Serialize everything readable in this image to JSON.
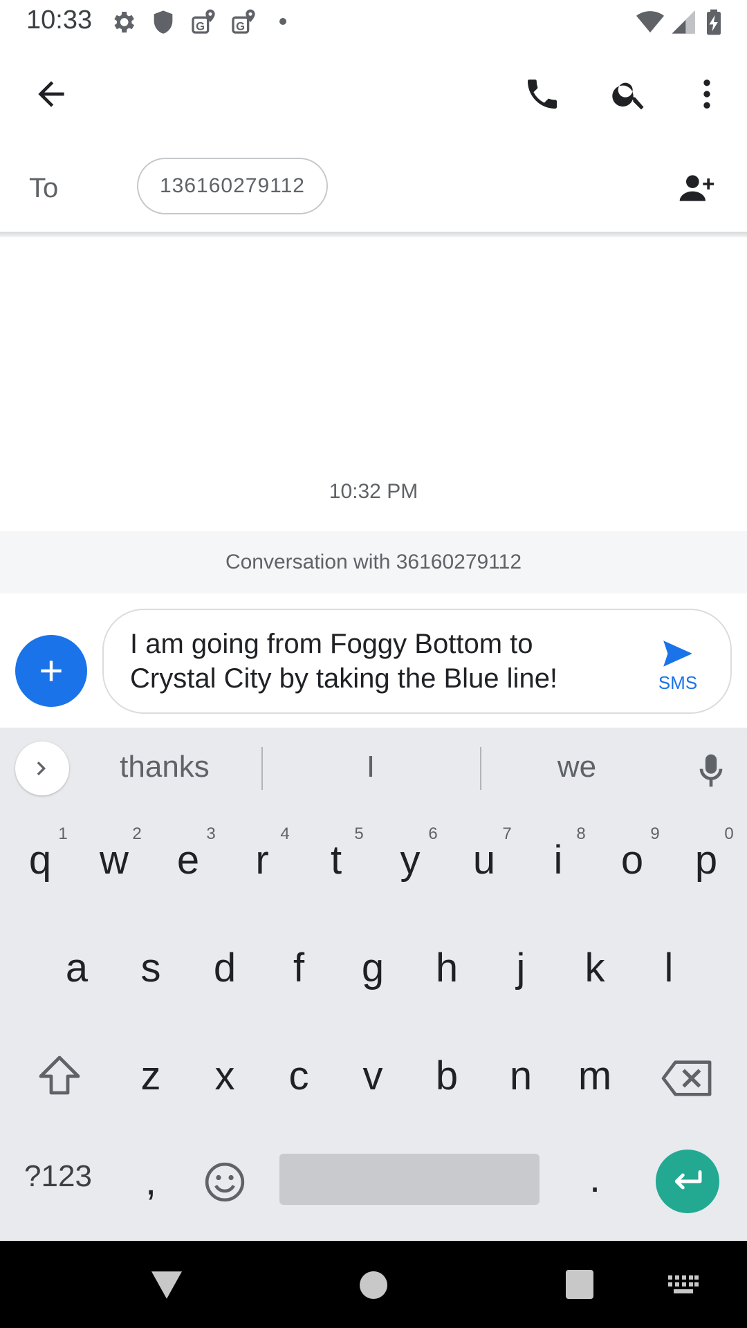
{
  "status_bar": {
    "time": "10:33",
    "left_icons": [
      "settings-icon",
      "shield-icon",
      "location-g-icon",
      "location-g-icon",
      "dot-icon"
    ],
    "right_icons": [
      "wifi-icon",
      "signal-icon",
      "battery-charging-icon"
    ]
  },
  "app_bar": {
    "back_icon": "arrow-back-icon",
    "actions": [
      "phone-icon",
      "search-icon",
      "more-vert-icon"
    ]
  },
  "recipient": {
    "to_label": "To",
    "chip": "136160279112",
    "add_icon": "add-person-icon"
  },
  "conversation": {
    "timestamp": "10:32 PM",
    "banner": "Conversation with 36160279112"
  },
  "compose": {
    "attach_icon": "plus-icon",
    "text": "I am going from Foggy Bottom to Crystal City by taking the Blue line!",
    "send_label": "SMS",
    "send_color": "#1a73e8"
  },
  "keyboard": {
    "suggestions": [
      "thanks",
      "I",
      "we"
    ],
    "row1": [
      "q",
      "w",
      "e",
      "r",
      "t",
      "y",
      "u",
      "i",
      "o",
      "p"
    ],
    "row1_hints": [
      "1",
      "2",
      "3",
      "4",
      "5",
      "6",
      "7",
      "8",
      "9",
      "0"
    ],
    "row2": [
      "a",
      "s",
      "d",
      "f",
      "g",
      "h",
      "j",
      "k",
      "l"
    ],
    "row3": [
      "z",
      "x",
      "c",
      "v",
      "b",
      "n",
      "m"
    ],
    "symbols_key": "?123",
    "comma_key": ",",
    "period_key": ".",
    "enter_color": "#23a892"
  },
  "nav_bar": {
    "icons": [
      "back-triangle-icon",
      "home-circle-icon",
      "recents-square-icon",
      "keyboard-icon"
    ]
  }
}
